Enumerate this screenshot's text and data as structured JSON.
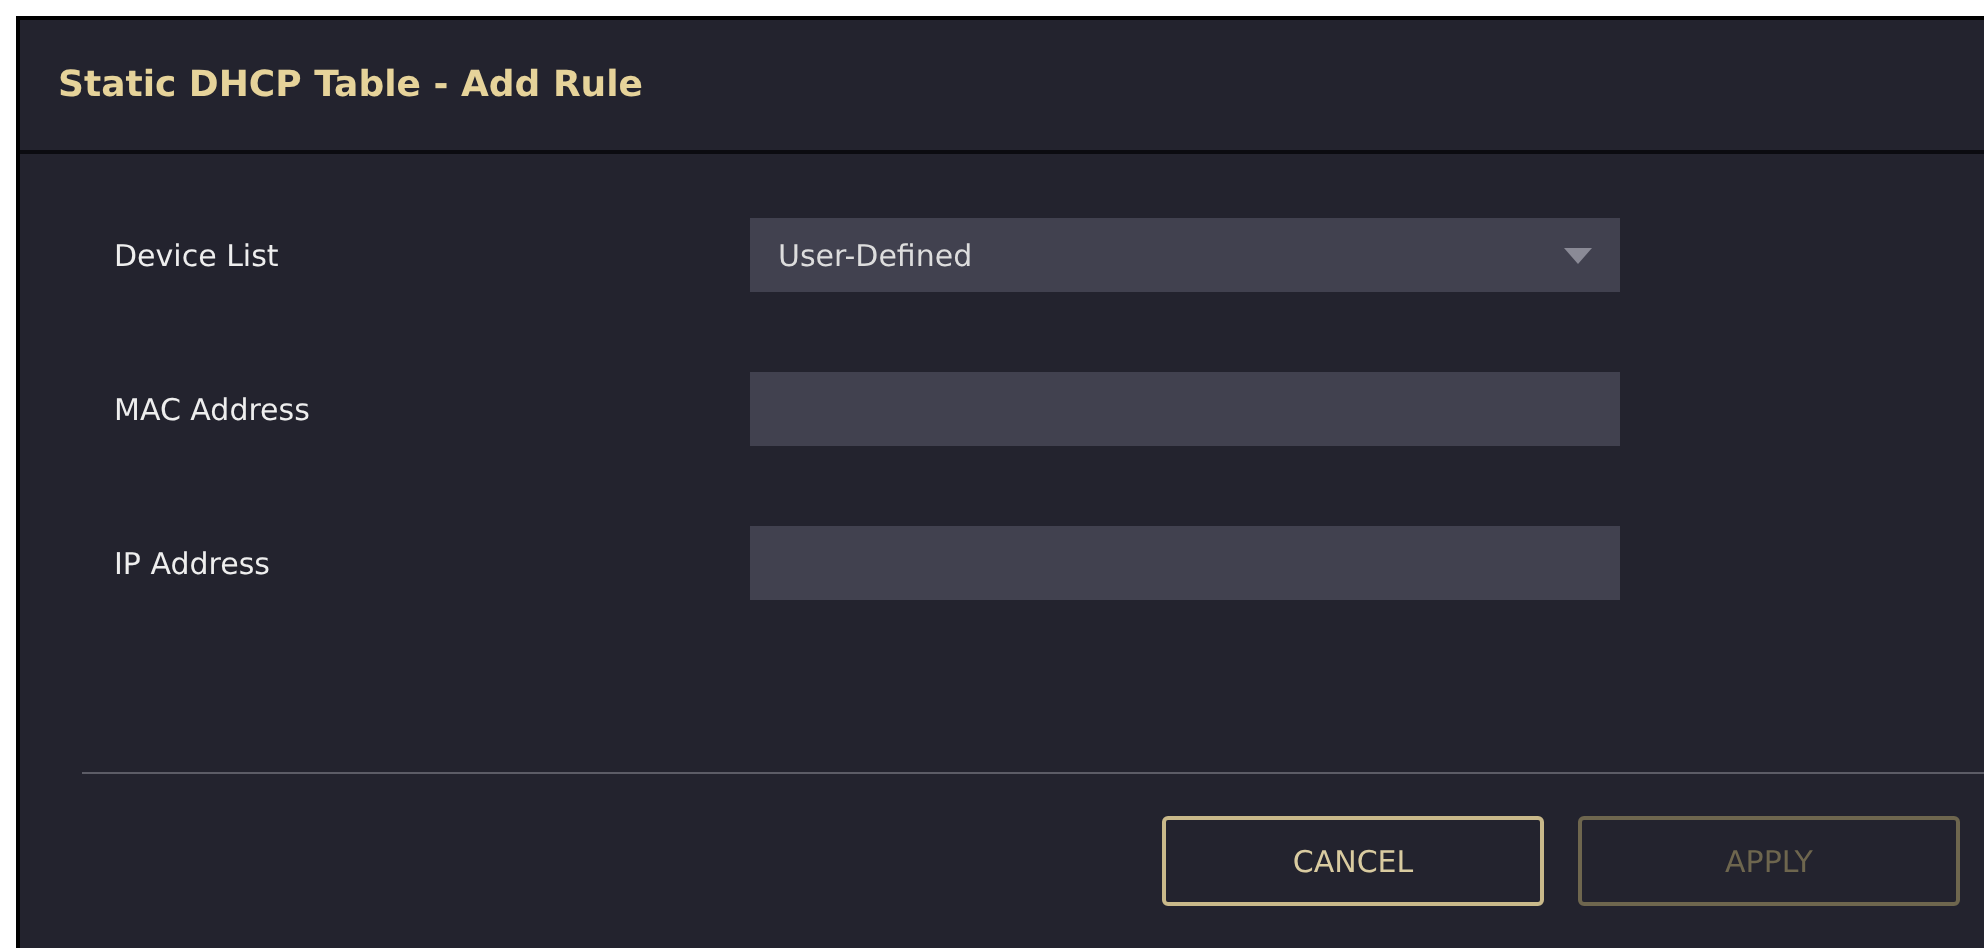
{
  "dialog": {
    "title": "Static DHCP Table - Add Rule"
  },
  "fields": [
    {
      "kind": "select",
      "label": "Device List",
      "value": "User-Defined"
    },
    {
      "kind": "text",
      "label": "MAC Address"
    },
    {
      "kind": "text",
      "label": "IP Address"
    }
  ],
  "buttons": [
    {
      "label": "CANCEL",
      "disabled": false
    },
    {
      "label": "APPLY",
      "disabled": true
    }
  ]
}
